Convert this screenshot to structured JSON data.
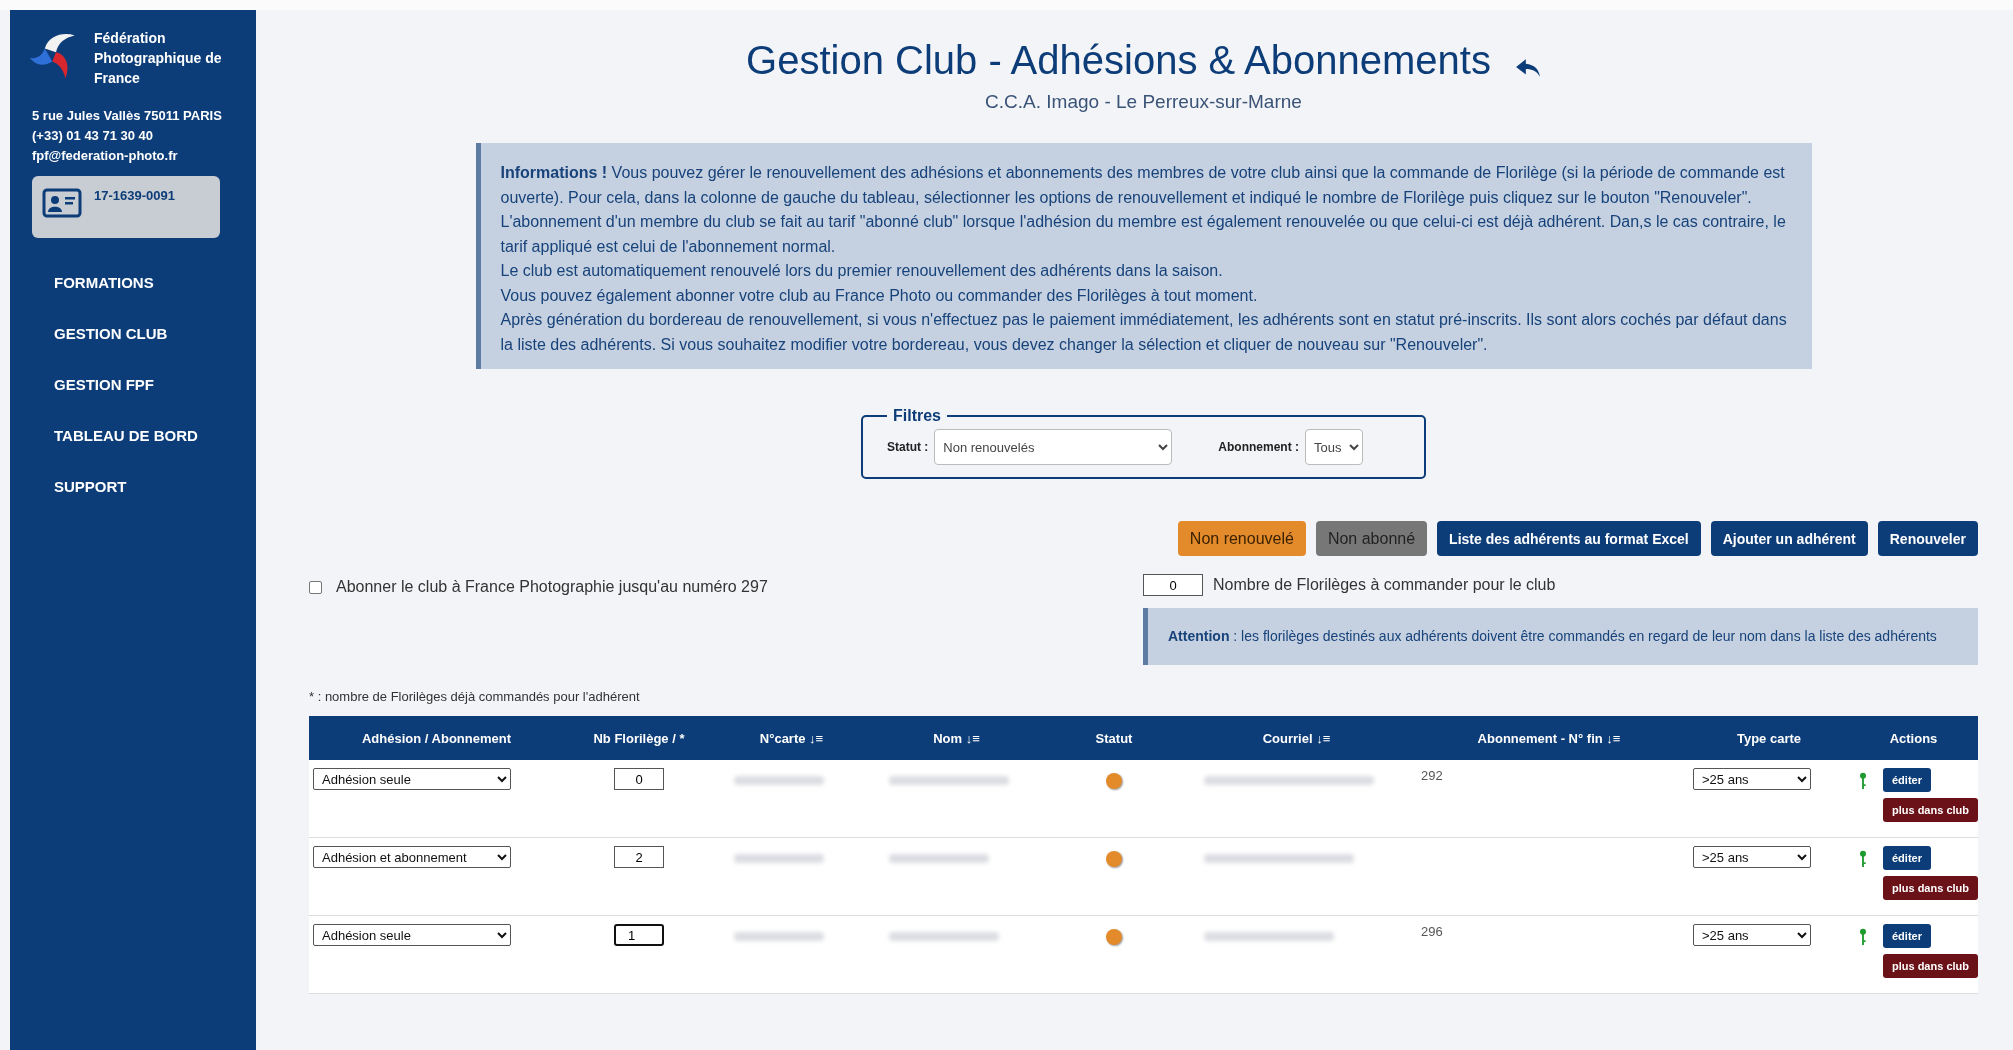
{
  "sidebar": {
    "org_name": "Fédération Photographique de France",
    "address": "5 rue Jules Vallès 75011 PARIS",
    "phone": "(+33) 01 43 71 30 40",
    "email": "fpf@federation-photo.fr",
    "card_number": "17-1639-0091",
    "items": [
      {
        "label": "FORMATIONS"
      },
      {
        "label": "GESTION CLUB"
      },
      {
        "label": "GESTION FPF"
      },
      {
        "label": "TABLEAU DE BORD"
      },
      {
        "label": "SUPPORT"
      }
    ]
  },
  "header": {
    "title": "Gestion Club - Adhésions & Abonnements",
    "subtitle": "C.C.A. Imago - Le Perreux-sur-Marne"
  },
  "info": {
    "lines": [
      "**Informations !** Vous pouvez gérer le renouvellement des adhésions et abonnements des membres de votre club ainsi que la commande de Florilège (si la période de commande est ouverte). Pour cela, dans la colonne de gauche du tableau, sélectionner les options de renouvellement et indiqué le nombre de Florilège puis cliquez sur le bouton \"Renouveler\".",
      "L'abonnement d'un membre du club se fait au tarif \"abonné club\" lorsque l'adhésion du membre est également renouvelée ou que celui-ci est déjà adhérent. Dan,s le cas contraire, le tarif appliqué est celui de l'abonnement normal.",
      "Le club est automatiquement renouvelé lors du premier renouvellement des adhérents dans la saison.",
      "Vous pouvez également abonner votre club au France Photo ou commander des Florilèges à tout moment.",
      "Après génération du bordereau de renouvellement, si vous n'effectuez pas le paiement immédiatement, les adhérents sont en statut pré-inscrits. Ils sont alors cochés par défaut dans la liste des adhérents. Si vous souhaitez modifier votre bordereau, vous devez changer la sélection et cliquer de nouveau sur \"Renouveler\"."
    ]
  },
  "filters": {
    "legend": "Filtres",
    "statut_label": "Statut :",
    "statut_value": "Non renouvelés",
    "abonnement_label": "Abonnement :",
    "abonnement_value": "Tous"
  },
  "buttons": [
    {
      "label": "Non renouvelé",
      "kind": "orange"
    },
    {
      "label": "Non abonné",
      "kind": "grey"
    },
    {
      "label": "Liste des adhérents au format Excel",
      "kind": "primary"
    },
    {
      "label": "Ajouter un adhérent",
      "kind": "primary"
    },
    {
      "label": "Renouveler",
      "kind": "primary"
    }
  ],
  "club_subscription": {
    "label": "Abonner le club à France Photographie jusqu'au numéro 297",
    "checked": false
  },
  "club_florilege": {
    "value": "0",
    "label": "Nombre de Florilèges à commander pour le club"
  },
  "attention": "**Attention** : les florilèges destinés aux adhérents doivent être commandés en regard de leur nom dans la liste des adhérents",
  "footnote": "* : nombre de Florilèges déjà commandés pour l'adhérent",
  "table": {
    "columns": [
      "Adhésion / Abonnement",
      "Nb Florilège / *",
      "N°carte ↓≡",
      "Nom ↓≡",
      "Statut",
      "Courriel ↓≡",
      "Abonnement - N° fin ↓≡",
      "Type carte",
      "Actions"
    ],
    "rows": [
      {
        "adhesion": "Adhésion seule",
        "florilege": "0",
        "focused": false,
        "color": "#e38a2a",
        "abonnement_fin": "292",
        "type_carte": ">25 ans",
        "edit": "éditer",
        "remove": "plus dans club"
      },
      {
        "adhesion": "Adhésion et abonnement",
        "florilege": "2",
        "focused": false,
        "color": "#e38a2a",
        "type_carte": ">25 ans",
        "edit": "éditer",
        "remove": "plus dans club"
      },
      {
        "adhesion": "Adhésion seule",
        "florilege": "1",
        "focused": true,
        "color": "#e38a2a",
        "abonnement_fin": "296",
        "type_carte": ">25 ans",
        "edit": "éditer",
        "remove": "plus dans club"
      }
    ]
  }
}
